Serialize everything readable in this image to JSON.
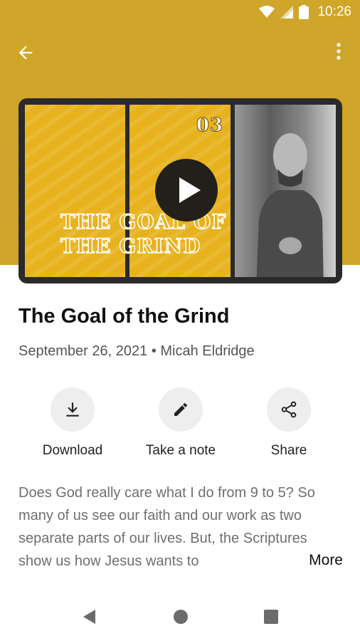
{
  "status_bar": {
    "time": "10:26",
    "icons": [
      "wifi-icon",
      "signal-icon",
      "battery-icon"
    ]
  },
  "app_bar": {
    "back_icon": "arrow-left-icon",
    "menu_icon": "more-vert-icon"
  },
  "video": {
    "episode_number": "03",
    "overlay_title": "THE GOAL OF\nTHE GRIND",
    "play_icon": "play-icon"
  },
  "sermon": {
    "title": "The Goal of the Grind",
    "date": "September 26, 2021",
    "separator": "•",
    "speaker": "Micah Eldridge"
  },
  "actions": [
    {
      "label": "Download",
      "icon": "download-icon"
    },
    {
      "label": "Take a note",
      "icon": "pencil-icon"
    },
    {
      "label": "Share",
      "icon": "share-icon"
    }
  ],
  "description": {
    "text": "Does God really care what I do from 9 to 5? So many of us see our faith and our work as two separate parts of our lives. But, the Scriptures show us how Jesus wants to",
    "more_label": "More"
  },
  "nav": {
    "back_icon": "nav-back-icon",
    "home_icon": "nav-home-icon",
    "recents_icon": "nav-recents-icon"
  },
  "colors": {
    "header": "#cfa52a",
    "artwork_yellow": "#e7b21d",
    "play_button": "#231f1b"
  }
}
